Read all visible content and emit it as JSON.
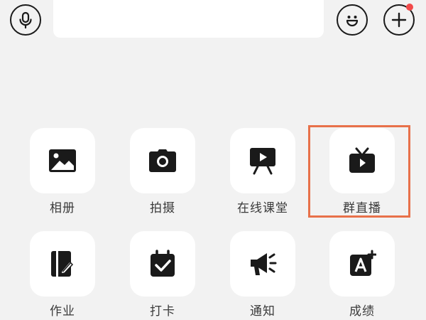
{
  "topbar": {
    "voice_icon": "microphone-icon",
    "input_value": "",
    "input_placeholder": "",
    "emoji_icon": "smiley-icon",
    "plus_icon": "plus-icon",
    "notify_color": "#f24a4a"
  },
  "grid": {
    "items": [
      {
        "label": "相册",
        "icon": "image-icon"
      },
      {
        "label": "拍摄",
        "icon": "camera-icon"
      },
      {
        "label": "在线课堂",
        "icon": "presentation-board-icon"
      },
      {
        "label": "群直播",
        "icon": "tv-play-icon"
      },
      {
        "label": "作业",
        "icon": "notebook-pen-icon"
      },
      {
        "label": "打卡",
        "icon": "calendar-check-icon"
      },
      {
        "label": "通知",
        "icon": "megaphone-icon"
      },
      {
        "label": "成绩",
        "icon": "grade-a-plus-icon"
      }
    ]
  },
  "highlight": {
    "target": "群直播",
    "color": "#e8714a"
  }
}
